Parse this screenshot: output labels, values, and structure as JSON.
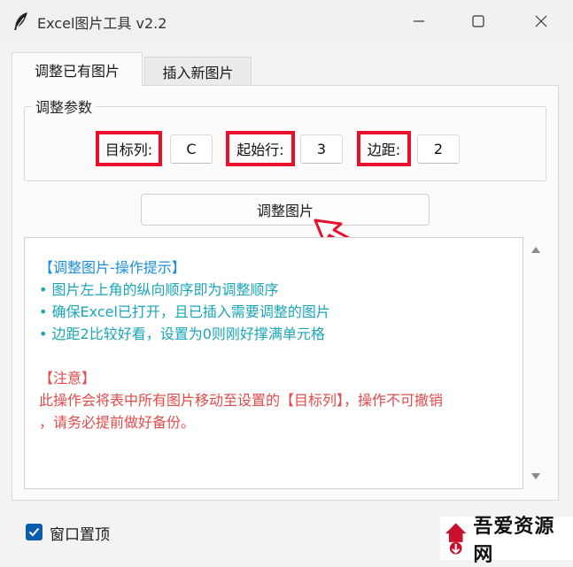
{
  "window": {
    "title": "Excel图片工具 v2.2",
    "icon": "feather-icon"
  },
  "tabs": [
    {
      "label": "调整已有图片",
      "active": true
    },
    {
      "label": "插入新图片",
      "active": false
    }
  ],
  "params": {
    "group_label": "调整参数",
    "target_col_label": "目标列:",
    "target_col_value": "C",
    "start_row_label": "起始行:",
    "start_row_value": "3",
    "margin_label": "边距:",
    "margin_value": "2"
  },
  "adjust_button": {
    "label": "调整图片"
  },
  "hints": {
    "title": "【调整图片-操作提示】",
    "items": [
      "• 图片左上角的纵向顺序即为调整顺序",
      "• 确保Excel已打开，且已插入需要调整的图片",
      "• 边距2比较好看，设置为0则刚好撑满单元格"
    ],
    "note_title": "【注意】",
    "note_lines": [
      "此操作会将表中所有图片移动至设置的【目标列】，操作不可撤销",
      "，请务必提前做好备份。"
    ]
  },
  "always_on_top": {
    "label": "窗口置顶",
    "checked": true
  },
  "watermark": {
    "text": "吾爱资源网"
  },
  "colors": {
    "highlight_border": "#e8102a",
    "hint_title": "#1a8fdc",
    "hint_items": "#1aa6b7",
    "note": "#e34a4a",
    "checkbox": "#0b5cad"
  }
}
